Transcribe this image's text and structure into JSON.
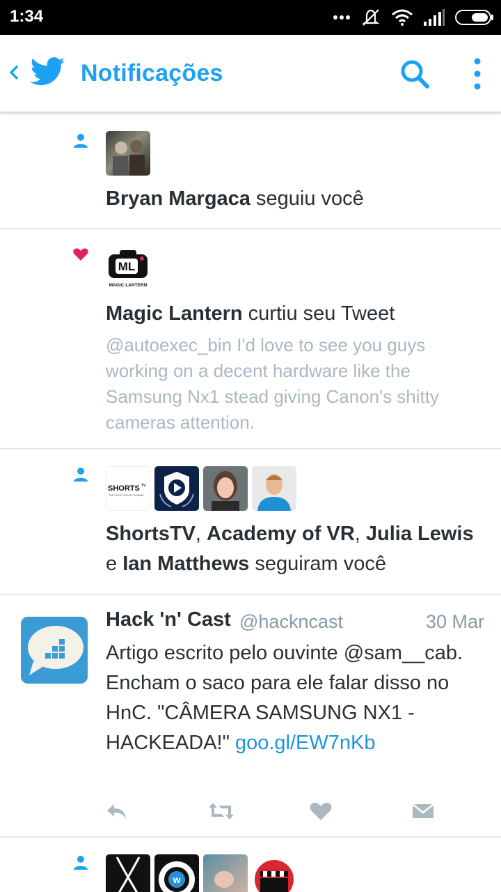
{
  "status_bar": {
    "time": "1:34"
  },
  "header": {
    "title": "Notificações"
  },
  "notifications": [
    {
      "type": "follow",
      "actors": [
        "Bryan Margaca"
      ],
      "action": "seguiu você"
    },
    {
      "type": "like",
      "actors": [
        "Magic Lantern"
      ],
      "action": "curtiu seu Tweet",
      "avatar_label": "MAGIC LANTERN",
      "avatar_logo": "ML",
      "quote": "@autoexec_bin I'd love to see you guys working on a decent hardware like the Samsung Nx1 stead giving Canon's shitty cameras attention."
    },
    {
      "type": "follow",
      "actors": [
        "ShortsTV",
        "Academy of VR",
        "Julia Lewis",
        "Ian Matthews"
      ],
      "separator": ", ",
      "conjunction": "e",
      "action": "seguiram você",
      "shorts_logo": "SHORTS",
      "shorts_sup": "TV",
      "shorts_tagline": "THE SHORT MOVIE CHANNEL"
    }
  ],
  "tweet": {
    "name": "Hack 'n' Cast",
    "handle": "@hackncast",
    "date": "30 Mar",
    "text": "Artigo escrito pelo ouvinte @sam__cab. Encham o saco para ele falar disso no HnC. \"CÂMERA SAMSUNG NX1 - HACKEADA!\" ",
    "link": "goo.gl/EW7nKb"
  },
  "colors": {
    "twitter_blue": "#1da1f2",
    "like_red": "#e0245e",
    "muted_gray": "#aab8c2",
    "text_dark": "#292f33"
  },
  "icons": [
    "back-chevron-icon",
    "twitter-bird-icon",
    "search-icon",
    "more-vert-icon",
    "person-icon",
    "heart-icon",
    "reply-icon",
    "retweet-icon",
    "like-icon",
    "direct-message-icon"
  ]
}
